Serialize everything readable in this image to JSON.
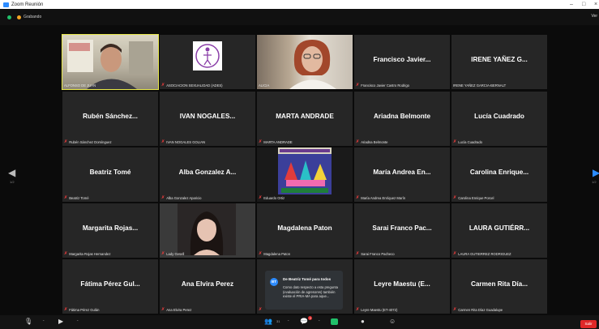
{
  "window": {
    "title": "Zoom Reunión"
  },
  "topbar": {
    "recording_label": "Grabando",
    "view_label": "Ver"
  },
  "tiles": [
    {
      "big": "",
      "label": "ALFONSO DE JUAN"
    },
    {
      "big": "",
      "label": "ASOCIACION SEXUALIDAD (ADES)"
    },
    {
      "big": "",
      "label": "ALICIA"
    },
    {
      "big": "Francisco Javier...",
      "label": "Francisco Javier Castro Rodrigo"
    },
    {
      "big": "IRENE YAÑEZ G...",
      "label": "IRENE YAÑEZ GARCIA-BERNALT"
    },
    {
      "big": "Rubén Sánchez...",
      "label": "Rubén Sánchez Domínguez"
    },
    {
      "big": "IVAN NOGALES...",
      "label": "IVAN NOGALES GOLIAN"
    },
    {
      "big": "MARTA ANDRADE",
      "label": "MARTA ANDRADE"
    },
    {
      "big": "Ariadna Belmonte",
      "label": "Ariadna Belmonte"
    },
    {
      "big": "Lucía Cuadrado",
      "label": "Lucía Cuadrado"
    },
    {
      "big": "Beatriz Tomé",
      "label": "Beatriz Tomé"
    },
    {
      "big": "Alba Gonzalez A...",
      "label": "Alba Gonzalez Aparicio"
    },
    {
      "big": "",
      "label": "Eduardo Ortiz"
    },
    {
      "big": "María Andrea En...",
      "label": "María Andrea Enríquez Marín"
    },
    {
      "big": "Carolina Enrique...",
      "label": "Carolina Enrique Porcel"
    },
    {
      "big": "Margarita Rojas...",
      "label": "Margarita Rojas Hernandez"
    },
    {
      "big": "",
      "label": "Lady Gesell"
    },
    {
      "big": "Magdalena Paton",
      "label": "Magdalena Paton"
    },
    {
      "big": "Sarai Franco Pac...",
      "label": "Sarai Franco Pacheco"
    },
    {
      "big": "LAURA GUTIÉRR...",
      "label": "LAURA GUTIERREZ RODRIGUEZ"
    },
    {
      "big": "Fátima Pérez Gul...",
      "label": "Fátima Pérez Gulán"
    },
    {
      "big": "Ana Elvira Perez",
      "label": "Ana Elvira Perez"
    },
    {
      "big": "",
      "label": ""
    },
    {
      "big": "Leyre Maestu (E...",
      "label": "Leyre Maestu (ET-4072)"
    },
    {
      "big": "Carmen Rita Día...",
      "label": "Carmen Rita Díaz Guadalupe"
    }
  ],
  "pagination": {
    "left": "1/2",
    "right": "1/2"
  },
  "chat": {
    "initials": "BT",
    "header": "De Beatriz Tomé para todos",
    "message": "Como dato respecto a esta pregunta (evaluación de agresores) también existe el PRIA-MA para aque..."
  },
  "toolbar": {
    "participants_count": "31",
    "chat_count": "3",
    "leave_label": "Salir"
  }
}
